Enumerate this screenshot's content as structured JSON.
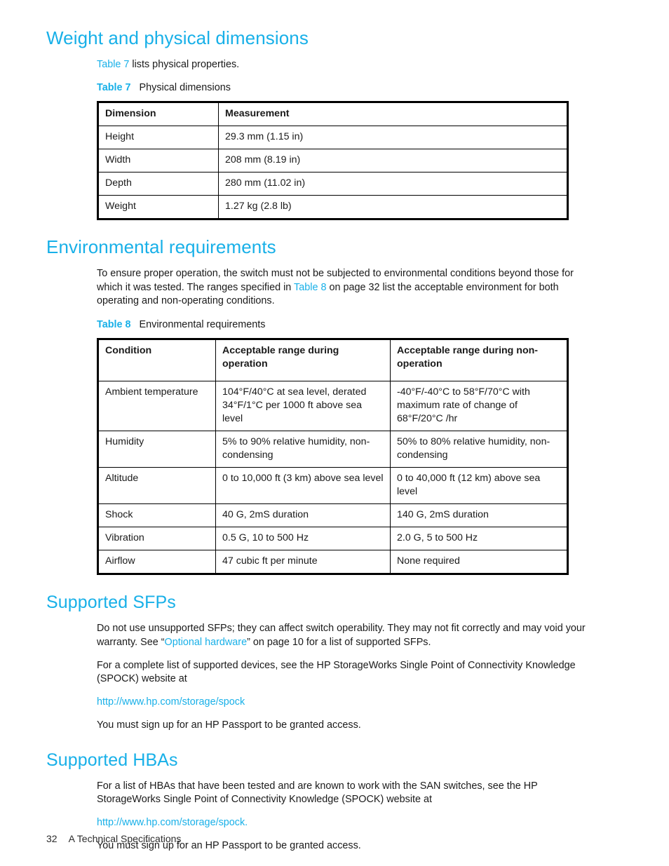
{
  "document": {
    "footer": {
      "page_number": "32",
      "chapter_label": "A Technical Specifications"
    }
  },
  "sections": {
    "weight": {
      "title": "Weight and physical dimensions",
      "intro_link": "Table 7",
      "intro_rest": " lists physical properties.",
      "caption_label": "Table 7",
      "caption_text": "Physical dimensions",
      "table": {
        "headers": [
          "Dimension",
          "Measurement"
        ],
        "rows": [
          [
            "Height",
            "29.3 mm (1.15 in)"
          ],
          [
            "Width",
            "208 mm (8.19 in)"
          ],
          [
            "Depth",
            "280 mm (11.02 in)"
          ],
          [
            "Weight",
            "1.27 kg (2.8 lb)"
          ]
        ]
      }
    },
    "environment": {
      "title": "Environmental requirements",
      "intro_part1": "To ensure proper operation, the switch must not be subjected to environmental conditions beyond those for which it was tested. The ranges specified in ",
      "intro_link": "Table 8",
      "intro_part2": " on page 32 list the acceptable environment for both operating and non-operating conditions.",
      "caption_label": "Table 8",
      "caption_text": "Environmental requirements",
      "table": {
        "headers": [
          "Condition",
          "Acceptable range during operation",
          "Acceptable range during non-operation"
        ],
        "rows": [
          [
            "Ambient temperature",
            "104°F/40°C at sea level, derated 34°F/1°C per 1000 ft above sea level",
            "-40°F/-40°C to 58°F/70°C with maximum rate of change of 68°F/20°C /hr"
          ],
          [
            "Humidity",
            "5% to 90% relative humidity, non-condensing",
            "50% to 80% relative humidity, non-condensing"
          ],
          [
            "Altitude",
            "0 to 10,000 ft (3 km) above sea level",
            "0 to 40,000 ft (12 km) above sea level"
          ],
          [
            "Shock",
            "40 G, 2mS duration",
            "140 G, 2mS duration"
          ],
          [
            "Vibration",
            "0.5 G, 10 to 500 Hz",
            " 2.0 G, 5 to 500 Hz"
          ],
          [
            "Airflow",
            "47 cubic ft per minute",
            "None required"
          ]
        ]
      }
    },
    "supported_sfps": {
      "title": "Supported SFPs",
      "para1_part1": "Do not use unsupported SFPs; they can affect switch operability. They may not fit correctly and may void your warranty. See “",
      "para1_link": "Optional hardware",
      "para1_part2": "” on page 10 for a list of supported SFPs.",
      "para2": "For a complete list of supported devices, see the HP StorageWorks Single Point of Connectivity Knowledge (SPOCK) website at",
      "url": "http://www.hp.com/storage/spock",
      "para3": "You must sign up for an HP Passport to be granted access."
    },
    "supported_hbas": {
      "title": "Supported HBAs",
      "para1": "For a list of HBAs that have been tested and are known to work with the SAN switches, see the HP StorageWorks Single Point of Connectivity Knowledge (SPOCK) website at",
      "url": "http://www.hp.com/storage/spock.",
      "para2": "You must sign up for an HP Passport to be granted access."
    }
  },
  "colors": {
    "accent": "#18b0e8",
    "text": "#1a1a1a",
    "table_border": "#000000"
  }
}
